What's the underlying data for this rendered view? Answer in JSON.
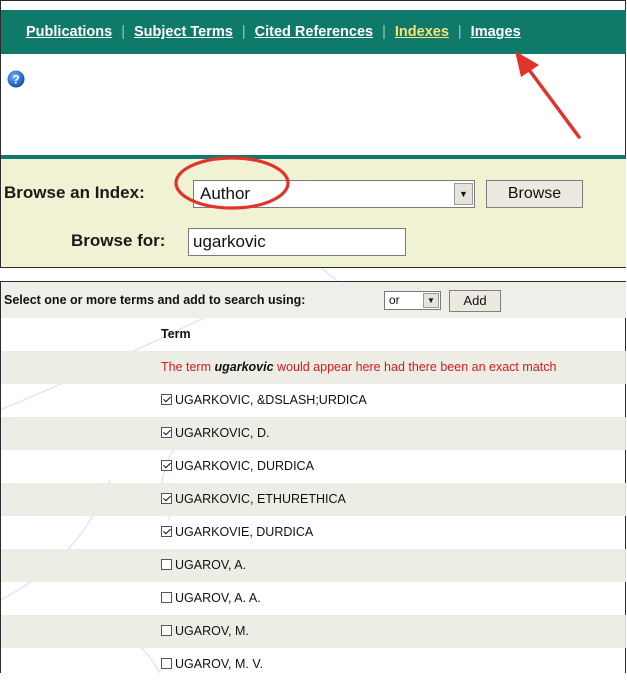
{
  "nav": {
    "items": [
      {
        "label": "Publications",
        "active": false
      },
      {
        "label": "Subject Terms",
        "active": false
      },
      {
        "label": "Cited References",
        "active": false
      },
      {
        "label": "Indexes",
        "active": true
      },
      {
        "label": "Images",
        "active": false
      }
    ]
  },
  "help": {
    "icon": "help-icon"
  },
  "browse": {
    "index_label": "Browse an Index:",
    "index_value": "Author",
    "button_label": "Browse",
    "for_label": "Browse for:",
    "for_value": "ugarkovic"
  },
  "results": {
    "toolbar_label": "Select one or more terms and add to search using:",
    "operator_value": "or",
    "add_label": "Add",
    "column_header": "Term",
    "no_match": {
      "before": "The term ",
      "term": "ugarkovic",
      "after": " would appear here had there been an exact match"
    },
    "terms": [
      {
        "label": "UGARKOVIC, &DSLASH;URDICA",
        "checked": true
      },
      {
        "label": "UGARKOVIC, D.",
        "checked": true
      },
      {
        "label": "UGARKOVIC, DURDICA",
        "checked": true
      },
      {
        "label": "UGARKOVIC, ETHURETHICA",
        "checked": true
      },
      {
        "label": "UGARKOVIE, DURDICA",
        "checked": true
      },
      {
        "label": "UGAROV, A.",
        "checked": false
      },
      {
        "label": "UGAROV, A. A.",
        "checked": false
      },
      {
        "label": "UGAROV, M.",
        "checked": false
      },
      {
        "label": "UGAROV, M. V.",
        "checked": false
      }
    ]
  },
  "colors": {
    "nav_bg": "#0f7a69",
    "nav_active": "#f5e27a",
    "browse_bg": "#f1f2d4",
    "annotation_red": "#e0342a",
    "no_match_red": "#d11d1d"
  }
}
